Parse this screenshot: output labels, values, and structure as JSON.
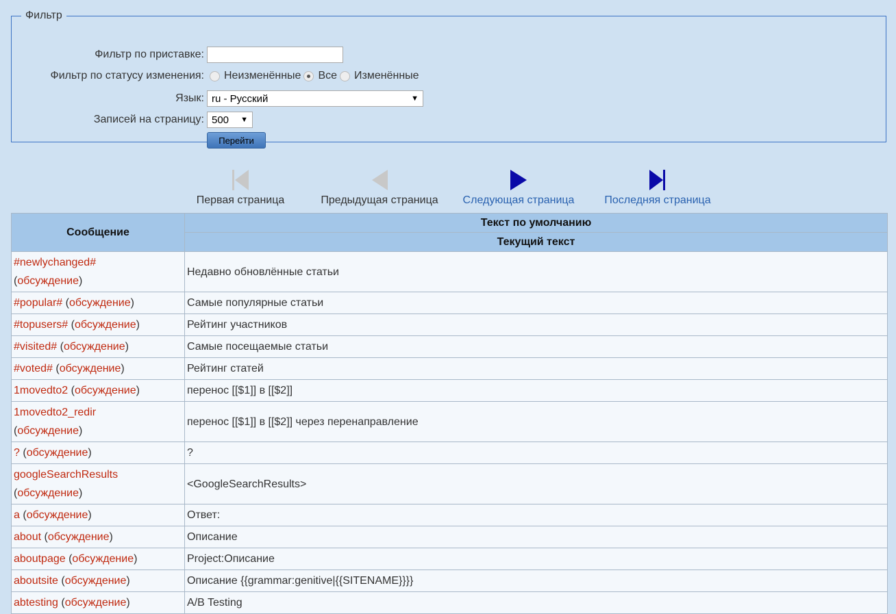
{
  "filter": {
    "legend": "Фильтр",
    "prefix_label": "Фильтр по приставке:",
    "prefix_value": "",
    "status_label": "Фильтр по статусу изменения:",
    "status_options": [
      "Неизменённые",
      "Все",
      "Изменённые"
    ],
    "status_selected": "Все",
    "lang_label": "Язык:",
    "lang_value": "ru - Русский",
    "per_page_label": "Записей на страницу:",
    "per_page_value": "500",
    "go": "Перейти"
  },
  "pager": {
    "first": "Первая страница",
    "prev": "Предыдущая страница",
    "next": "Следующая страница",
    "last": "Последняя страница"
  },
  "table": {
    "col_message": "Сообщение",
    "col_default": "Текст по умолчанию",
    "col_current": "Текущий текст",
    "talk": "обсуждение",
    "rows": [
      {
        "key": "#newlychanged#",
        "text": "Недавно обновлённые статьи",
        "wrap": true
      },
      {
        "key": "#popular#",
        "text": "Самые популярные статьи"
      },
      {
        "key": "#topusers#",
        "text": "Рейтинг участников"
      },
      {
        "key": "#visited#",
        "text": "Самые посещаемые статьи"
      },
      {
        "key": "#voted#",
        "text": "Рейтинг статей"
      },
      {
        "key": "1movedto2",
        "text": "перенос [[$1]] в [[$2]]"
      },
      {
        "key": "1movedto2_redir",
        "text": "перенос [[$1]] в [[$2]] через перенаправление",
        "wrap": true
      },
      {
        "key": "?",
        "text": "?"
      },
      {
        "key": "googleSearchResults",
        "text": "<GoogleSearchResults>",
        "wrap": true
      },
      {
        "key": "a",
        "text": "Ответ:"
      },
      {
        "key": "about",
        "text": "Описание"
      },
      {
        "key": "aboutpage",
        "text": "Project:Описание"
      },
      {
        "key": "aboutsite",
        "text": "Описание {{grammar:genitive|{{SITENAME}}}}"
      },
      {
        "key": "abtesting",
        "text": "A/B Testing"
      }
    ]
  }
}
